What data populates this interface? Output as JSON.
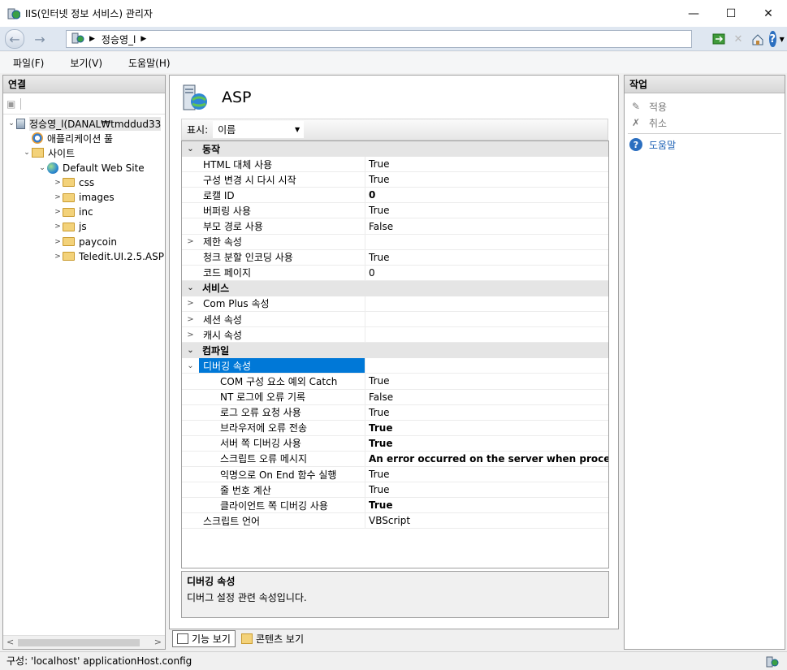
{
  "window": {
    "title": "IIS(인터넷 정보 서비스) 관리자",
    "minimize": "—",
    "maximize": "☐",
    "close": "✕"
  },
  "address": {
    "crumb": "정승영_l"
  },
  "menu": {
    "file": "파일(F)",
    "view": "보기(V)",
    "help": "도움말(H)"
  },
  "connections": {
    "header": "연결",
    "tree": [
      {
        "label": "정승영_l(DANAL₩tmddud33",
        "depth": 0,
        "toggle": "⌄",
        "icon": "server-icon"
      },
      {
        "label": "애플리케이션 풀",
        "depth": 1,
        "toggle": "",
        "icon": "app-pool-icon"
      },
      {
        "label": "사이트",
        "depth": 1,
        "toggle": "⌄",
        "icon": "sites-folder-icon"
      },
      {
        "label": "Default Web Site",
        "depth": 2,
        "toggle": "⌄",
        "icon": "globe-icon"
      },
      {
        "label": "css",
        "depth": 3,
        "toggle": ">",
        "icon": "folder-icon"
      },
      {
        "label": "images",
        "depth": 3,
        "toggle": ">",
        "icon": "folder-icon"
      },
      {
        "label": "inc",
        "depth": 3,
        "toggle": ">",
        "icon": "folder-icon"
      },
      {
        "label": "js",
        "depth": 3,
        "toggle": ">",
        "icon": "folder-icon"
      },
      {
        "label": "paycoin",
        "depth": 3,
        "toggle": ">",
        "icon": "folder-icon"
      },
      {
        "label": "Teledit.UI.2.5.ASP",
        "depth": 3,
        "toggle": ">",
        "icon": "folder-icon"
      }
    ]
  },
  "feature": {
    "title": "ASP",
    "display_label": "표시:",
    "display_value": "이름"
  },
  "properties": [
    {
      "type": "cat",
      "exp": "⌄",
      "name": "동작"
    },
    {
      "type": "prop",
      "name": "HTML 대체 사용",
      "value": "True"
    },
    {
      "type": "prop",
      "name": "구성 변경 시 다시 시작",
      "value": "True"
    },
    {
      "type": "prop",
      "name": "로캘 ID",
      "value": "0",
      "bold": true
    },
    {
      "type": "prop",
      "name": "버퍼링 사용",
      "value": "True"
    },
    {
      "type": "prop",
      "name": "부모 경로 사용",
      "value": "False"
    },
    {
      "type": "prop",
      "exp": ">",
      "name": "제한 속성",
      "value": ""
    },
    {
      "type": "prop",
      "name": "청크 분할 인코딩 사용",
      "value": "True"
    },
    {
      "type": "prop",
      "name": "코드 페이지",
      "value": "0"
    },
    {
      "type": "cat",
      "exp": "⌄",
      "name": "서비스"
    },
    {
      "type": "prop",
      "exp": ">",
      "name": "Com Plus 속성",
      "value": ""
    },
    {
      "type": "prop",
      "exp": ">",
      "name": "세션 속성",
      "value": ""
    },
    {
      "type": "prop",
      "exp": ">",
      "name": "캐시 속성",
      "value": ""
    },
    {
      "type": "cat",
      "exp": "⌄",
      "name": "컴파일"
    },
    {
      "type": "prop",
      "exp": "⌄",
      "name": "디버깅 속성",
      "value": "",
      "selected": true
    },
    {
      "type": "sub",
      "name": "COM 구성 요소 예외 Catch",
      "value": "True"
    },
    {
      "type": "sub",
      "name": "NT 로그에 오류 기록",
      "value": "False"
    },
    {
      "type": "sub",
      "name": "로그 오류 요청 사용",
      "value": "True"
    },
    {
      "type": "sub",
      "name": "브라우저에 오류 전송",
      "value": "True",
      "bold": true
    },
    {
      "type": "sub",
      "name": "서버 쪽 디버깅 사용",
      "value": "True",
      "bold": true
    },
    {
      "type": "sub",
      "name": "스크립트 오류 메시지",
      "value": "An error occurred on the server when processing t",
      "bold": true
    },
    {
      "type": "sub",
      "name": "익명으로 On End 함수 실행",
      "value": "True"
    },
    {
      "type": "sub",
      "name": "줄 번호 계산",
      "value": "True"
    },
    {
      "type": "sub",
      "name": "클라이언트 쪽 디버깅 사용",
      "value": "True",
      "bold": true
    },
    {
      "type": "prop",
      "name": "스크립트 언어",
      "value": "VBScript"
    }
  ],
  "description": {
    "title": "디버깅 속성",
    "text": "디버그 설정 관련 속성입니다."
  },
  "view_tabs": {
    "features": "기능 보기",
    "content": "콘텐츠 보기"
  },
  "actions": {
    "header": "작업",
    "apply": "적용",
    "cancel": "취소",
    "help": "도움말"
  },
  "status": {
    "text": "구성: 'localhost' applicationHost.config"
  }
}
